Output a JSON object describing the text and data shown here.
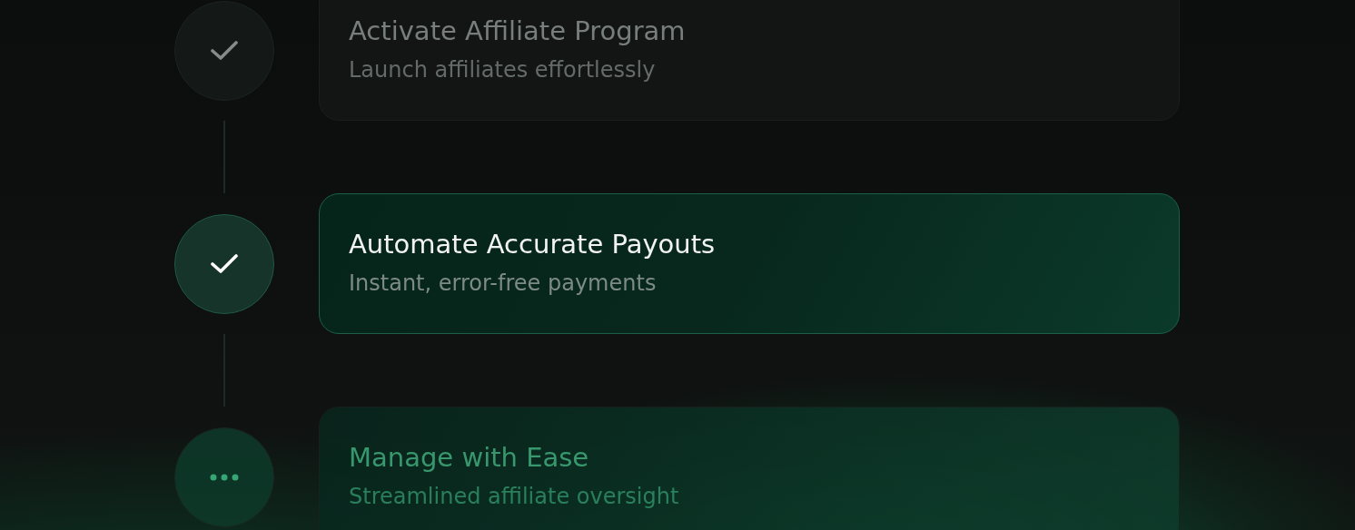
{
  "steps": [
    {
      "title": "Activate Affiliate Program",
      "subtitle": "Launch affiliates effortlessly",
      "kind": "done"
    },
    {
      "title": "Automate Accurate Payouts",
      "subtitle": "Instant, error-free payments",
      "kind": "active"
    },
    {
      "title": "Manage with Ease",
      "subtitle": "Streamlined affiliate oversight",
      "kind": "pending"
    }
  ]
}
